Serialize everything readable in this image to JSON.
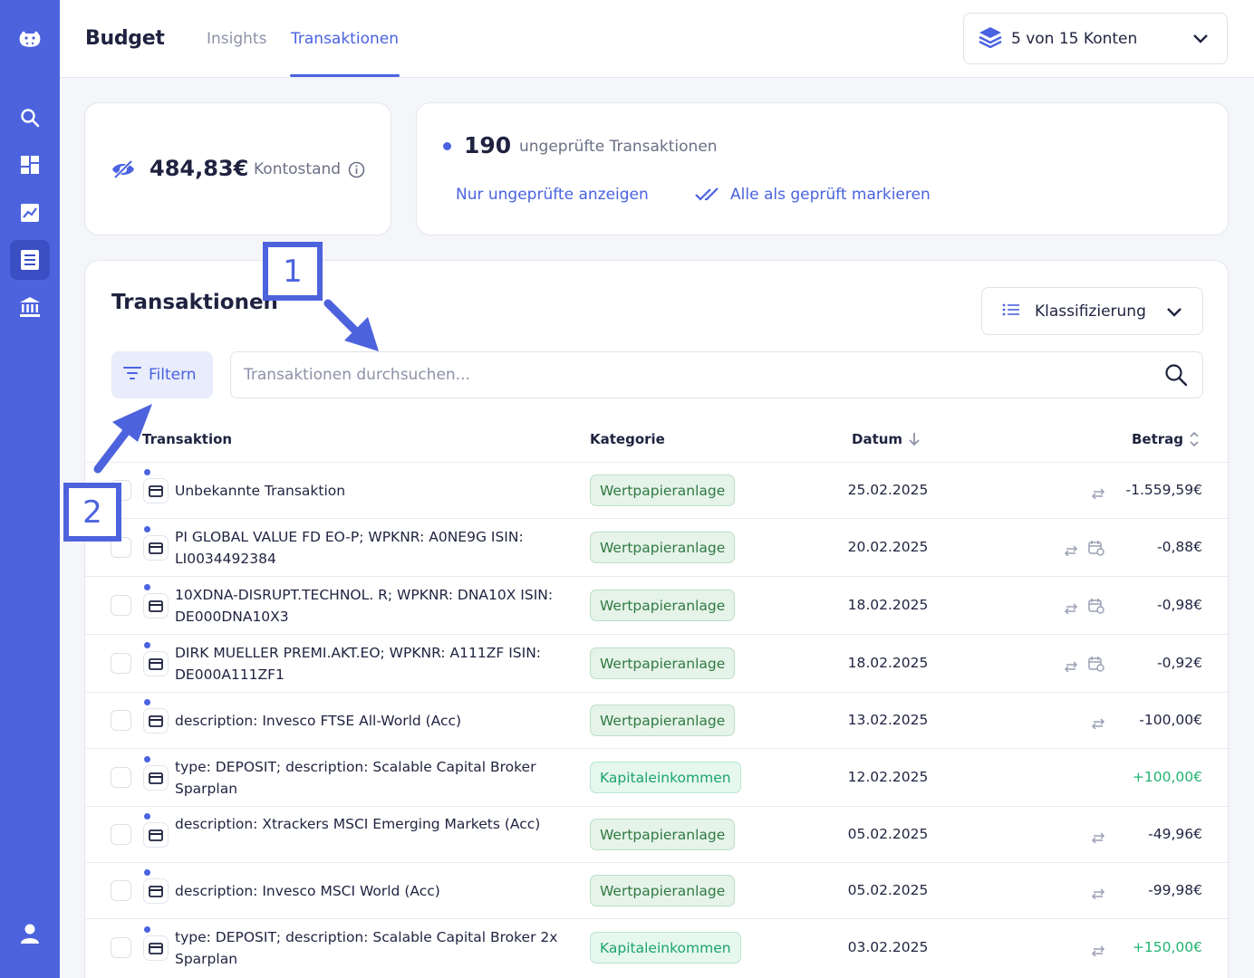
{
  "colors": {
    "accent": "#4a63e0",
    "sidebar": "#4d63dd",
    "positive": "#21b36f",
    "badge_wertpapier": "#2f7a42",
    "badge_kapital": "#1aa46a"
  },
  "sidebar": {
    "items": [
      {
        "icon": "hippo-logo-icon"
      },
      {
        "icon": "search-icon"
      },
      {
        "icon": "dashboard-icon"
      },
      {
        "icon": "chart-icon"
      },
      {
        "icon": "transactions-icon",
        "active": true
      },
      {
        "icon": "bank-icon"
      },
      {
        "icon": "user-icon"
      }
    ]
  },
  "header": {
    "title": "Budget",
    "tabs": [
      {
        "label": "Insights",
        "active": false
      },
      {
        "label": "Transaktionen",
        "active": true
      }
    ],
    "accounts_select": "5 von 15 Konten"
  },
  "balance": {
    "amount": "484,83€",
    "label": "Kontostand"
  },
  "unreviewed": {
    "count": "190",
    "label": "ungeprüfte Transaktionen",
    "show_link": "Nur ungeprüfte anzeigen",
    "mark_all_link": "Alle als geprüft markieren"
  },
  "transactions": {
    "title": "Transaktionen",
    "classification_select": "Klassifizierung",
    "filter_label": "Filtern",
    "search_placeholder": "Transaktionen durchsuchen...",
    "columns": {
      "transaction": "Transaktion",
      "category": "Kategorie",
      "date": "Datum",
      "amount": "Betrag"
    },
    "rows": [
      {
        "name": "Unbekannte Transaktion",
        "category": "Wertpapieranlage",
        "date": "25.02.2025",
        "amount": "-1.559,59€",
        "icons": [
          "transfer"
        ]
      },
      {
        "name": "PI GLOBAL VALUE FD EO-P; WPKNR: A0NE9G ISIN: LI0034492384",
        "category": "Wertpapieranlage",
        "date": "20.02.2025",
        "amount": "-0,88€",
        "icons": [
          "transfer",
          "recurring"
        ]
      },
      {
        "name": "10XDNA-DISRUPT.TECHNOL. R; WPKNR: DNA10X ISIN: DE000DNA10X3",
        "category": "Wertpapieranlage",
        "date": "18.02.2025",
        "amount": "-0,98€",
        "icons": [
          "transfer",
          "recurring"
        ]
      },
      {
        "name": "DIRK MUELLER PREMI.AKT.EO; WPKNR: A111ZF ISIN: DE000A111ZF1",
        "category": "Wertpapieranlage",
        "date": "18.02.2025",
        "amount": "-0,92€",
        "icons": [
          "transfer",
          "recurring"
        ]
      },
      {
        "name": "description: Invesco FTSE All-World (Acc)",
        "category": "Wertpapieranlage",
        "date": "13.02.2025",
        "amount": "-100,00€",
        "icons": [
          "transfer"
        ]
      },
      {
        "name": "type: DEPOSIT; description: Scalable Capital Broker Sparplan",
        "category": "Kapitaleinkommen",
        "date": "12.02.2025",
        "amount": "+100,00€",
        "icons": []
      },
      {
        "name": "description: Xtrackers MSCI Emerging Markets (Acc)",
        "category": "Wertpapieranlage",
        "date": "05.02.2025",
        "amount": "-49,96€",
        "icons": [
          "transfer"
        ]
      },
      {
        "name": "description: Invesco MSCI World (Acc)",
        "category": "Wertpapieranlage",
        "date": "05.02.2025",
        "amount": "-99,98€",
        "icons": [
          "transfer"
        ]
      },
      {
        "name": "type: DEPOSIT; description: Scalable Capital Broker 2x Sparplan",
        "category": "Kapitaleinkommen",
        "date": "03.02.2025",
        "amount": "+150,00€",
        "icons": [
          "transfer"
        ]
      }
    ]
  },
  "annotations": [
    {
      "label": "1"
    },
    {
      "label": "2"
    }
  ]
}
